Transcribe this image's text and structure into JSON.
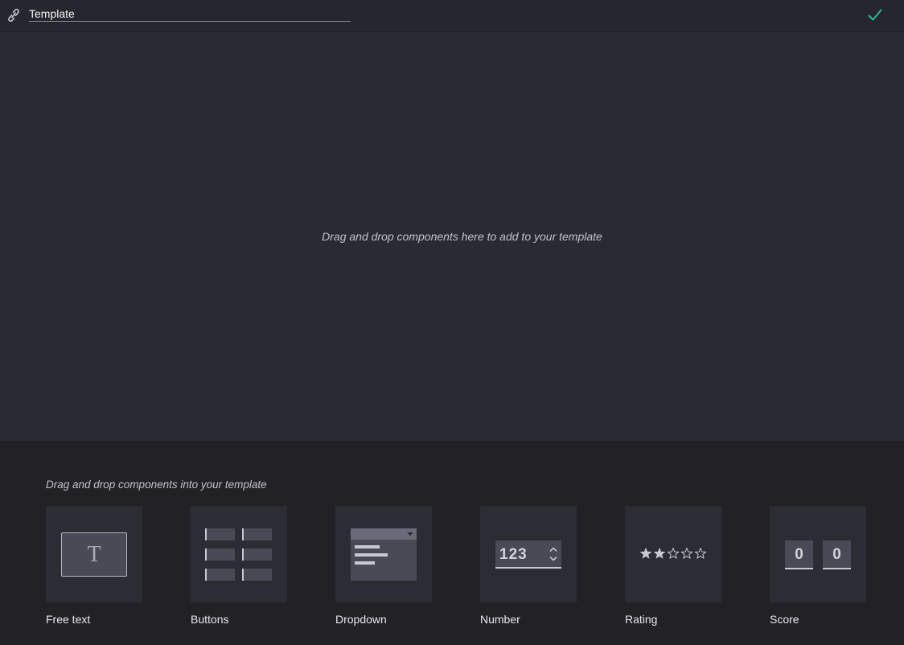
{
  "header": {
    "title_value": "Template",
    "link_icon": "link-icon",
    "confirm_icon": "checkmark-icon",
    "confirm_color": "#1fbf8f"
  },
  "canvas": {
    "hint": "Drag and drop components here to add to your template"
  },
  "components_panel": {
    "hint": "Drag and drop components into your template",
    "items": [
      {
        "label": "Free text",
        "preview_glyph": "T"
      },
      {
        "label": "Buttons"
      },
      {
        "label": "Dropdown"
      },
      {
        "label": "Number",
        "preview_value": "123"
      },
      {
        "label": "Rating",
        "stars_filled": 2,
        "stars_total": 5
      },
      {
        "label": "Score",
        "preview_values": [
          "0",
          "0"
        ]
      }
    ]
  },
  "colors": {
    "background": "#2a2a33",
    "panel": "#212126",
    "tile": "#2c2c35",
    "accent": "#1fbf8f"
  }
}
